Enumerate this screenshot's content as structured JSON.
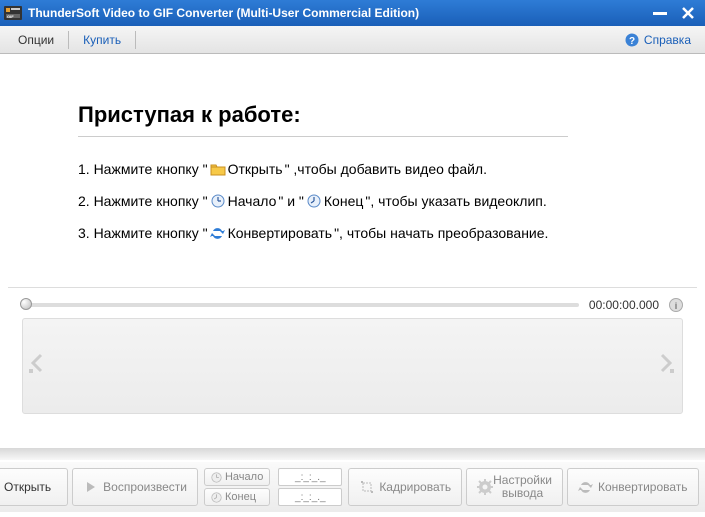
{
  "window": {
    "title": "ThunderSoft Video to GIF Converter (Multi-User Commercial Edition)"
  },
  "menu": {
    "options": "Опции",
    "buy": "Купить",
    "help": "Справка"
  },
  "welcome": {
    "heading": "Приступая к работе:",
    "step1_pre": "1. Нажмите кнопку \" ",
    "step1_btn": "Открыть",
    "step1_post": "\" ,чтобы добавить видео файл.",
    "step2_pre": "2. Нажмите кнопку \" ",
    "step2_btn1": "Начало",
    "step2_mid": " \" и \" ",
    "step2_btn2": "Конец",
    "step2_post": " \", чтобы указать видеоклип.",
    "step3_pre": "3. Нажмите кнопку \" ",
    "step3_btn": "Конвертировать",
    "step3_post": " \", чтобы начать преобразование."
  },
  "player": {
    "time": "00:00:00.000"
  },
  "toolbar": {
    "open": "Открыть",
    "play": "Воспроизвести",
    "start": "Начало",
    "end": "Конец",
    "start_time_placeholder": "_:_:_._",
    "end_time_placeholder": "_:_:_._",
    "crop": "Кадрировать",
    "output_line1": "Настройки",
    "output_line2": "вывода",
    "convert": "Конвертировать"
  }
}
